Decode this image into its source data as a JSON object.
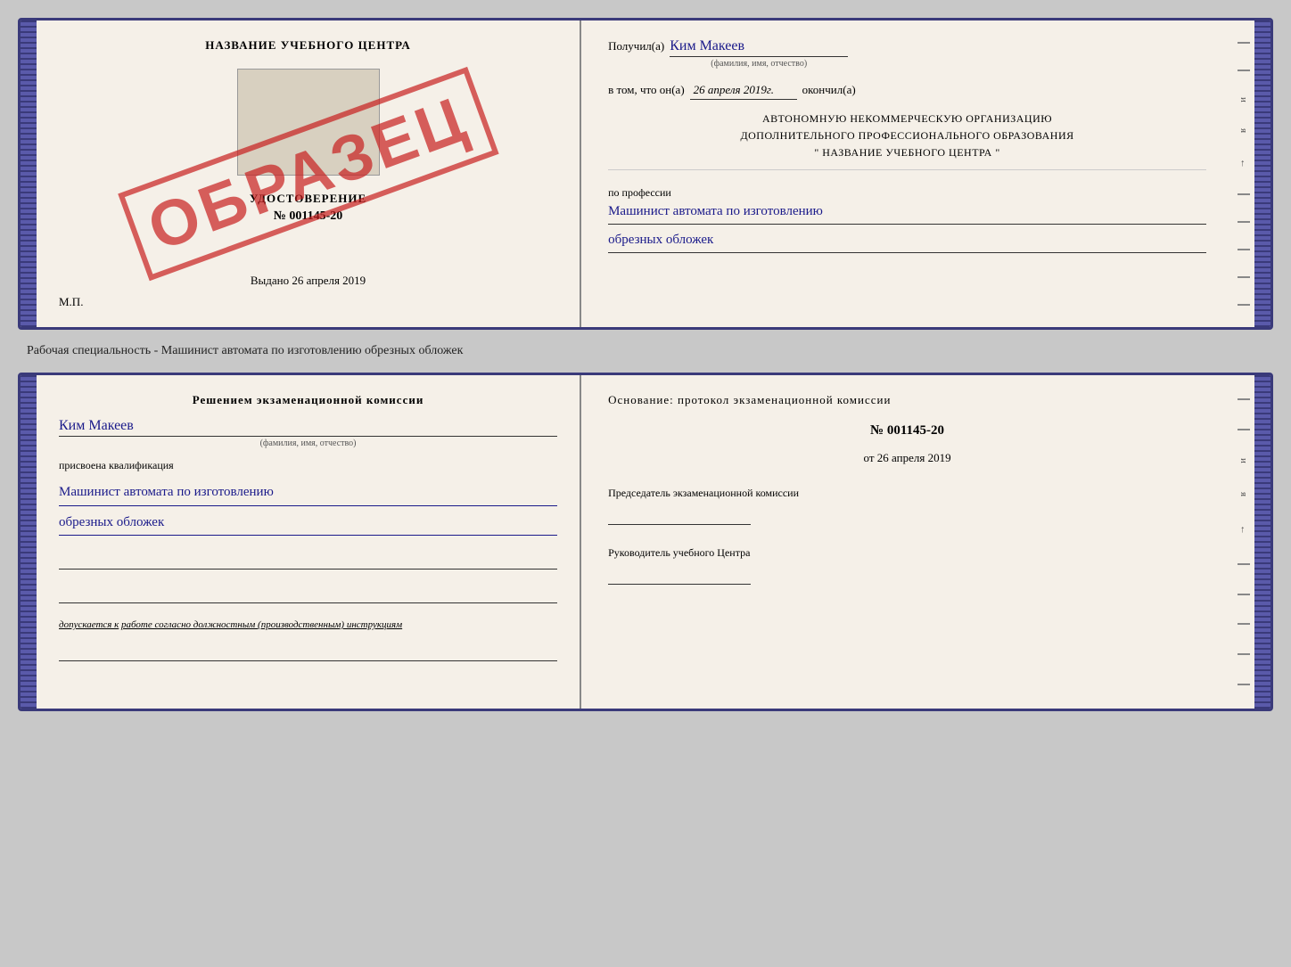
{
  "top_doc": {
    "left": {
      "title": "НАЗВАНИЕ УЧЕБНОГО ЦЕНТРА",
      "stamp_text": "ОБРАЗЕЦ",
      "cert_label": "УДОСТОВЕРЕНИЕ",
      "cert_number": "№ 001145-20",
      "vydano": "Выдано",
      "vydano_date": "26 апреля 2019",
      "mp": "М.П."
    },
    "right": {
      "poluchil": "Получил(а)",
      "name": "Ким Макеев",
      "fio_label": "(фамилия, имя, отчество)",
      "vtom": "в том, что он(а)",
      "date": "26 апреля 2019г.",
      "okonchill": "окончил(а)",
      "org_line1": "АВТОНОМНУЮ НЕКОММЕРЧЕСКУЮ ОРГАНИЗАЦИЮ",
      "org_line2": "ДОПОЛНИТЕЛЬНОГО ПРОФЕССИОНАЛЬНОГО ОБРАЗОВАНИЯ",
      "org_line3": "\"  НАЗВАНИЕ УЧЕБНОГО ЦЕНТРА  \"",
      "po_professii": "по профессии",
      "profession1": "Машинист автомата по изготовлению",
      "profession2": "обрезных обложек",
      "deco_i": "и",
      "deco_ya": "я",
      "deco_arrow": "←"
    }
  },
  "between_label": "Рабочая специальность - Машинист автомата по изготовлению обрезных обложек",
  "bottom_doc": {
    "left": {
      "resheniem": "Решением экзаменационной комиссии",
      "name": "Ким Макеев",
      "fio_label": "(фамилия, имя, отчество)",
      "prisvoena": "присвоена квалификация",
      "kvalif1": "Машинист автомата по изготовлению",
      "kvalif2": "обрезных обложек",
      "dopusk_text": "допускается к",
      "dopusk_italic": "работе согласно должностным (производственным) инструкциям"
    },
    "right": {
      "osnovanie": "Основание: протокол экзаменационной комиссии",
      "protocol_num": "№ 001145-20",
      "ot_label": "от",
      "date": "26 апреля 2019",
      "predsedatel_label": "Председатель экзаменационной комиссии",
      "rukovoditel_label": "Руководитель учебного Центра",
      "deco_i": "и",
      "deco_ya": "я",
      "deco_arrow": "←"
    }
  }
}
